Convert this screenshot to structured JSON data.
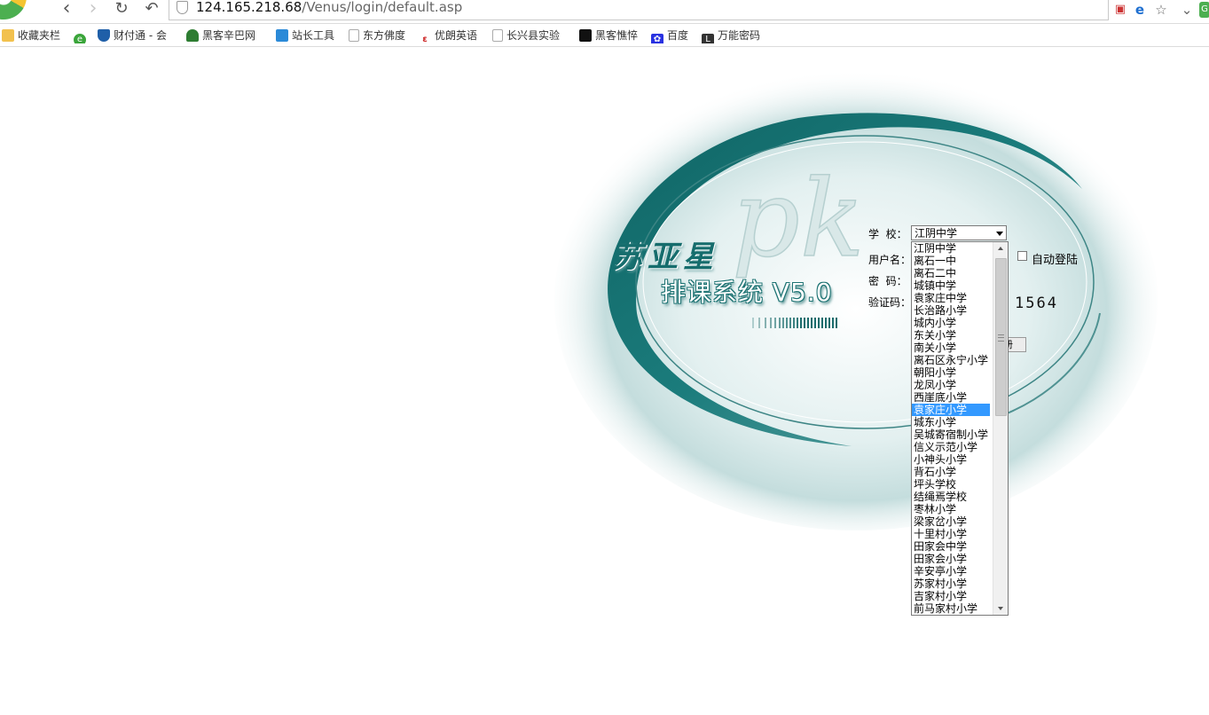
{
  "browser": {
    "url_host": "124.165.218.68",
    "url_path": "/Venus/login/default.asp",
    "bookmarks": [
      {
        "label": "收藏夹栏",
        "icon": "folder-icon"
      },
      {
        "label": "",
        "icon": "ie-icon"
      },
      {
        "label": "财付通 - 会",
        "icon": "tenpay-shield-icon"
      },
      {
        "label": "黑客辛巴网",
        "icon": "tree-icon"
      },
      {
        "label": "站长工具",
        "icon": "webmaster-icon"
      },
      {
        "label": "东方佛度",
        "icon": "page-icon"
      },
      {
        "label": "优朗英语",
        "icon": "e-icon"
      },
      {
        "label": "长兴县实验",
        "icon": "page-icon"
      },
      {
        "label": "黑客憔悴",
        "icon": "black-square-icon"
      },
      {
        "label": "百度",
        "icon": "baidu-paw-icon"
      },
      {
        "label": "万能密码",
        "icon": "l-icon"
      }
    ]
  },
  "app": {
    "title_main": "苏亚星",
    "title_sub": "排课系统 V5.0"
  },
  "form": {
    "school_label": "学  校：",
    "username_label": "用户名：",
    "password_label": "密  码：",
    "captcha_label": "验证码：",
    "school_selected": "江阴中学",
    "auto_login_label": "自动登陆",
    "captcha_value": "1564",
    "button_fragment": "册"
  },
  "school_options": [
    "江阴中学",
    "离石一中",
    "离石二中",
    "城镇中学",
    "袁家庄中学",
    "长治路小学",
    "城内小学",
    "东关小学",
    "南关小学",
    "离石区永宁小学",
    "朝阳小学",
    "龙凤小学",
    "西崖底小学",
    "袁家庄小学",
    "城东小学",
    "吴城寄宿制小学",
    "信义示范小学",
    "小神头小学",
    "背石小学",
    "坪头学校",
    "结绳焉学校",
    "枣林小学",
    "梁家岔小学",
    "十里村小学",
    "田家会中学",
    "田家会小学",
    "辛安亭小学",
    "苏家村小学",
    "吉家村小学",
    "前马家村小学"
  ],
  "selected_option_index": 13,
  "colors": {
    "accent": "#166d6d",
    "selection": "#3399ff"
  }
}
